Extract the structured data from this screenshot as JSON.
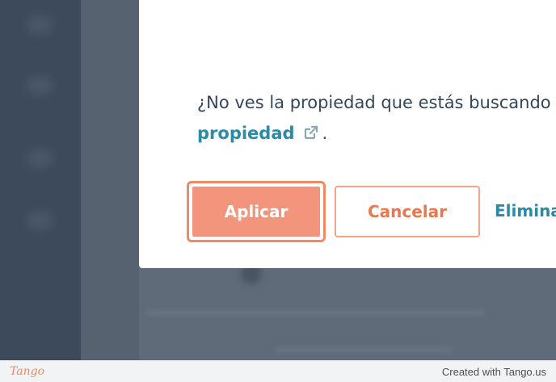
{
  "dialog": {
    "prompt_text": "¿No ves la propiedad que estás buscando",
    "prompt_link": "propiedad",
    "prompt_end": "."
  },
  "actions": {
    "apply_label": "Aplicar",
    "cancel_label": "Cancelar",
    "remove_label": "Eliminar"
  },
  "footer": {
    "logo": "Tango",
    "credit": "Created with Tango.us"
  },
  "colors": {
    "accent": "#f2957c",
    "link": "#2a8aa8",
    "text": "#33475b",
    "overlay": "#5f6b79"
  },
  "icons": {
    "external_link": "external-link-icon"
  }
}
